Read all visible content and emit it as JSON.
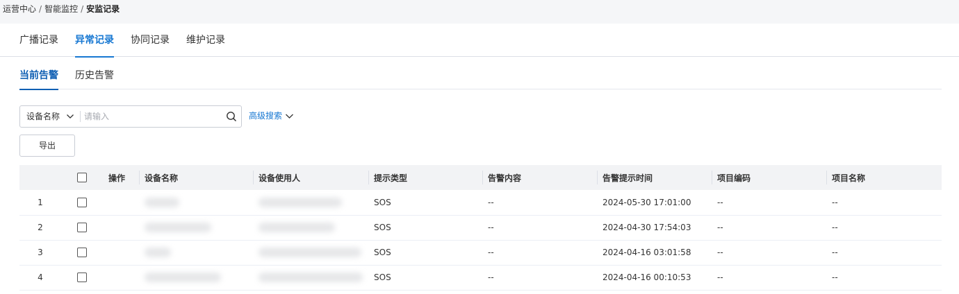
{
  "breadcrumb": {
    "items": [
      "运营中心",
      "智能监控"
    ],
    "separator": "/",
    "current": "安监记录"
  },
  "main_tabs": [
    {
      "label": "广播记录",
      "active": false
    },
    {
      "label": "异常记录",
      "active": true
    },
    {
      "label": "协同记录",
      "active": false
    },
    {
      "label": "维护记录",
      "active": false
    }
  ],
  "sub_tabs": [
    {
      "label": "当前告警",
      "active": true
    },
    {
      "label": "历史告警",
      "active": false
    }
  ],
  "search": {
    "field_select": "设备名称",
    "placeholder": "请输入",
    "value": ""
  },
  "advanced_search_label": "高级搜索",
  "export_label": "导出",
  "table": {
    "headers": [
      "操作",
      "设备名称",
      "设备使用人",
      "提示类型",
      "告警内容",
      "告警提示时间",
      "项目编码",
      "项目名称"
    ],
    "rows": [
      {
        "index": "1",
        "type": "SOS",
        "content": "--",
        "time": "2024-05-30 17:01:00",
        "project_code": "--",
        "project_name": "--"
      },
      {
        "index": "2",
        "type": "SOS",
        "content": "--",
        "time": "2024-04-30 17:54:03",
        "project_code": "--",
        "project_name": "--"
      },
      {
        "index": "3",
        "type": "SOS",
        "content": "--",
        "time": "2024-04-16 03:01:58",
        "project_code": "--",
        "project_name": "--"
      },
      {
        "index": "4",
        "type": "SOS",
        "content": "--",
        "time": "2024-04-16 00:10:53",
        "project_code": "--",
        "project_name": "--"
      }
    ]
  },
  "colors": {
    "accent": "#1677d2",
    "sub_tab_accent": "#0f5fb3",
    "header_bg": "#f2f3f5",
    "breadcrumb_bg": "#f5f6f8"
  }
}
